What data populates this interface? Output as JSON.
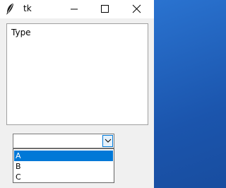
{
  "window": {
    "title": "tk",
    "icon": "tk-feather-icon",
    "controls": [
      "minimize-icon",
      "maximize-icon",
      "close-icon"
    ]
  },
  "textbox": {
    "text": "Type"
  },
  "combobox": {
    "value": "",
    "arrow_icon": "chevron-down-icon",
    "options": [
      "A",
      "B",
      "C"
    ],
    "highlighted": "A"
  },
  "colors": {
    "selection": "#0078d7",
    "window_bg": "#f0f0f0",
    "desktop": "#1e5fb8"
  }
}
